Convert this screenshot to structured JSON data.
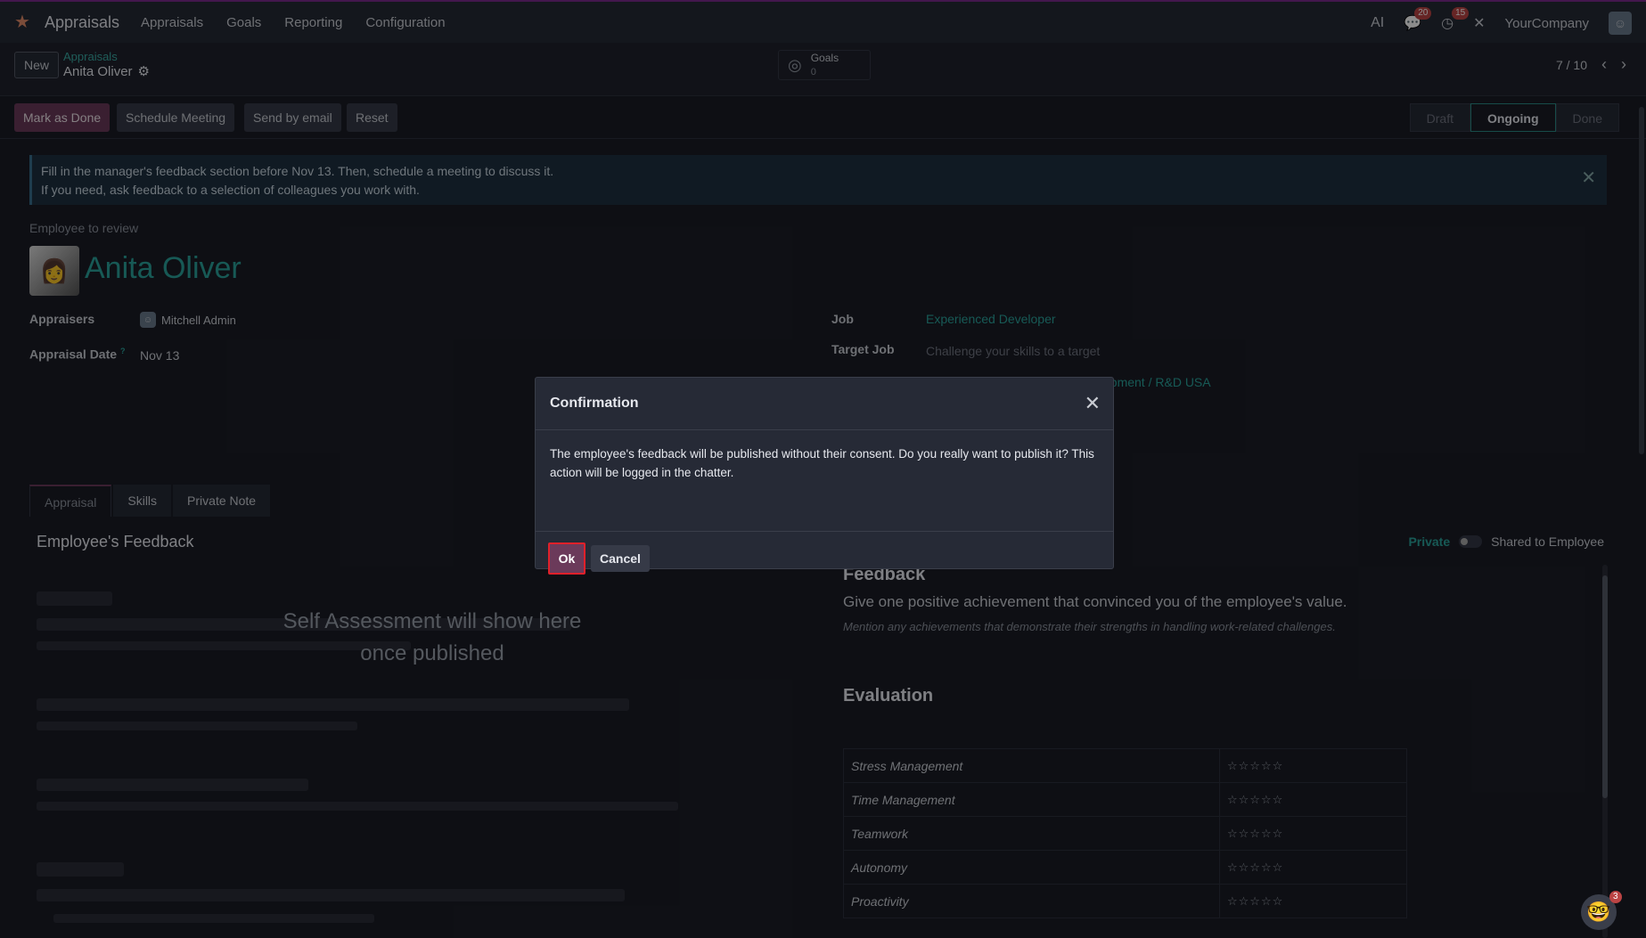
{
  "navbar": {
    "app_name": "Appraisals",
    "menu": [
      "Appraisals",
      "Goals",
      "Reporting",
      "Configuration"
    ],
    "messages_count": "20",
    "activities_count": "15",
    "company": "YourCompany"
  },
  "control": {
    "new_label": "New",
    "breadcrumb": "Appraisals",
    "record_name": "Anita Oliver",
    "goals_label": "Goals",
    "goals_count": "0",
    "pager": "7 / 10"
  },
  "statusbar": {
    "mark_done": "Mark as Done",
    "schedule": "Schedule Meeting",
    "send_email": "Send by email",
    "reset": "Reset",
    "stages": [
      "Draft",
      "Ongoing",
      "Done"
    ]
  },
  "alert": {
    "line1": "Fill in the manager's feedback section before Nov 13. Then, schedule a meeting to discuss it.",
    "line2": "If you need, ask feedback to a selection of colleagues you work with."
  },
  "employee": {
    "label": "Employee to review",
    "name": "Anita Oliver",
    "appraisers_label": "Appraisers",
    "appraiser": "Mitchell Admin",
    "date_label": "Appraisal Date",
    "date_help": "?",
    "date": "Nov 13",
    "job_label": "Job",
    "job": "Experienced Developer",
    "target_label": "Target Job",
    "target_placeholder": "Challenge your skills to a target",
    "department_partial": "opment / R&D USA"
  },
  "tabs": [
    "Appraisal",
    "Skills",
    "Private Note"
  ],
  "feedback": {
    "section_title": "Employee's Feedback",
    "self_message": "Self Assessment will show here once published",
    "private_label": "Private",
    "shared_label": "Shared to Employee",
    "title": "Feedback",
    "question": "Give one positive achievement that convinced you of the employee's value.",
    "hint": "Mention any achievements that demonstrate their strengths in handling work-related challenges."
  },
  "evaluation": {
    "title": "Evaluation",
    "rows": [
      "Stress Management",
      "Time Management",
      "Teamwork",
      "Autonomy",
      "Proactivity"
    ],
    "stars": "☆☆☆☆☆"
  },
  "modal": {
    "title": "Confirmation",
    "body": "The employee's feedback will be published without their consent. Do you really want to publish it? This action will be logged in the chatter.",
    "ok": "Ok",
    "cancel": "Cancel"
  },
  "chat_badge": "3",
  "colors": {
    "accent": "#6b3a5a",
    "teal": "#2aa39c",
    "background": "#1b1d26"
  }
}
